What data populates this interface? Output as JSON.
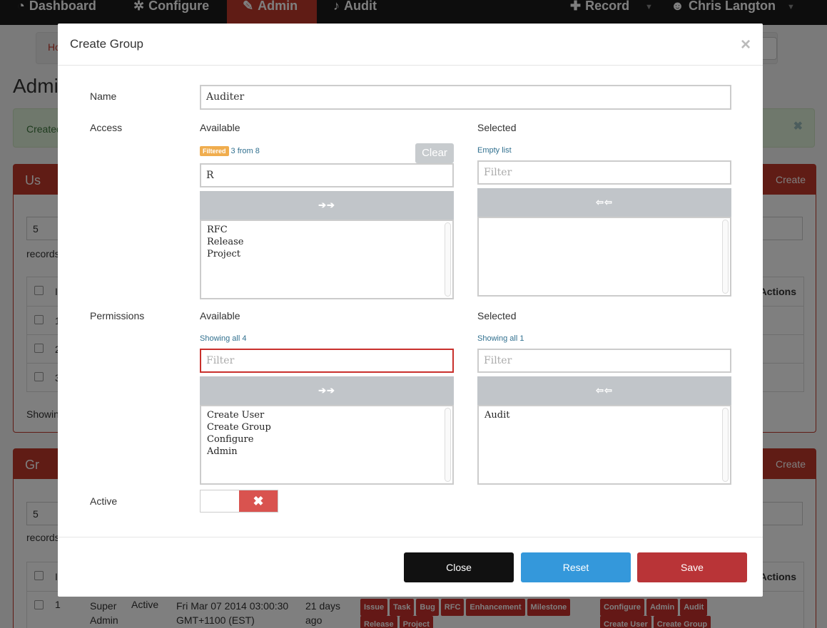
{
  "navbar": {
    "dashboard": "Dashboard",
    "configure": "Configure",
    "admin": "Admin",
    "audit": "Audit",
    "record": "Record",
    "user": "Chris Langton"
  },
  "page": {
    "crumb": "Ho",
    "title": "Admi",
    "alert": "Created",
    "users_panel": {
      "title": "Us",
      "create": "Create",
      "length": "5",
      "records": "records",
      "rows": [
        "1",
        "2",
        "3"
      ],
      "header_first": "I",
      "actions": "Actions",
      "footer": "Showin"
    },
    "groups_panel": {
      "title": "Gr",
      "create": "Create",
      "length": "5",
      "records": "records",
      "header_first": "I",
      "actions": "Actions"
    },
    "group_row": {
      "id": "1",
      "name": "Super Admin",
      "status": "Active",
      "created": "Fri Mar 07 2014 03:00:30 GMT+1100 (EST)",
      "ago": "21 days ago",
      "access": [
        "Issue",
        "Task",
        "Bug",
        "RFC",
        "Enhancement",
        "Milestone",
        "Release",
        "Project"
      ],
      "permissions": [
        "Configure",
        "Admin",
        "Audit",
        "Create User",
        "Create Group"
      ]
    }
  },
  "modal": {
    "title": "Create Group",
    "close_glyph": "×",
    "labels": {
      "name": "Name",
      "access": "Access",
      "permissions": "Permissions",
      "active": "Active"
    },
    "name_value": "Auditer",
    "access": {
      "available_label": "Available",
      "selected_label": "Selected",
      "filtered_badge": "Filtered",
      "filtered_info": "3 from 8",
      "clear": "Clear",
      "filter_value": "R",
      "available_items": [
        "RFC",
        "Release",
        "Project"
      ],
      "selected_info": "Empty list",
      "selected_filter_placeholder": "Filter",
      "selected_items": []
    },
    "permissions": {
      "available_label": "Available",
      "selected_label": "Selected",
      "available_info": "Showing all 4",
      "available_filter_placeholder": "Filter",
      "available_items": [
        "Create User",
        "Create Group",
        "Configure",
        "Admin"
      ],
      "selected_info": "Showing all 1",
      "selected_filter_placeholder": "Filter",
      "selected_items": [
        "Audit"
      ]
    },
    "move_right": "➔➔",
    "move_left": "⇦⇦",
    "active_off_glyph": "✖",
    "buttons": {
      "close": "Close",
      "reset": "Reset",
      "save": "Save"
    },
    "colors": {
      "close": "#111111",
      "reset": "#3498db",
      "save": "#b93437"
    }
  }
}
